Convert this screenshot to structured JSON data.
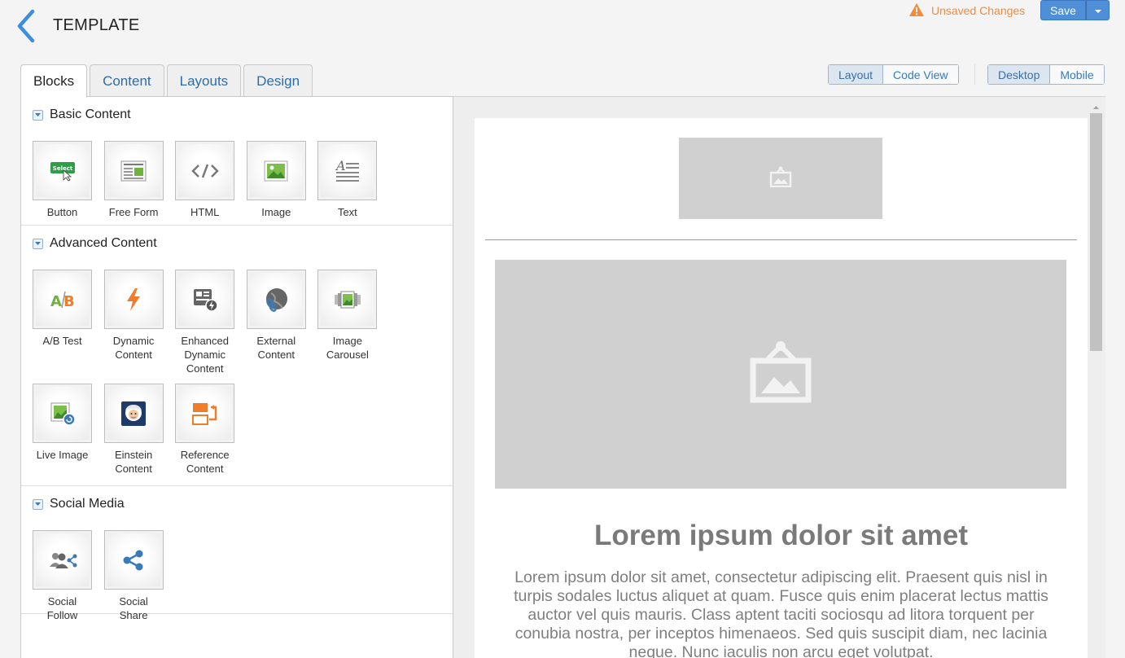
{
  "header": {
    "title": "TEMPLATE",
    "unsaved": "Unsaved Changes",
    "save_label": "Save"
  },
  "tabs": [
    {
      "label": "Blocks",
      "active": true
    },
    {
      "label": "Content"
    },
    {
      "label": "Layouts"
    },
    {
      "label": "Design"
    }
  ],
  "view_toggle": {
    "options": [
      "Layout",
      "Code View"
    ],
    "selected": "Layout"
  },
  "device_toggle": {
    "options": [
      "Desktop",
      "Mobile"
    ],
    "selected": "Desktop"
  },
  "sections": {
    "basic": {
      "title": "Basic Content",
      "blocks": [
        "Button",
        "Free Form",
        "HTML",
        "Image",
        "Text"
      ]
    },
    "advanced": {
      "title": "Advanced Content",
      "blocks": [
        "A/B Test",
        "Dynamic Content",
        "Enhanced Dynamic Content",
        "External Content",
        "Image Carousel",
        "Live Image",
        "Einstein Content",
        "Reference Content"
      ]
    },
    "social": {
      "title": "Social Media",
      "blocks": [
        "Social Follow",
        "Social Share"
      ]
    }
  },
  "preview": {
    "headline": "Lorem ipsum dolor sit amet",
    "body": "Lorem ipsum dolor sit amet, consectetur adipiscing elit. Praesent quis nisl in turpis sodales luctus aliquet at quam. Fusce quis enim placerat lectus mattis auctor vel quis mauris. Class aptent taciti sociosqu ad litora torquent per conubia nostra, per inceptos himenaeos. Sed quis suscipit diam, nec lacinia neque. Nunc iaculis non arcu eget volutpat."
  },
  "colors": {
    "accent": "#4f8fd8",
    "warning": "#f28b3c",
    "placeholder": "#d0d0d0"
  }
}
